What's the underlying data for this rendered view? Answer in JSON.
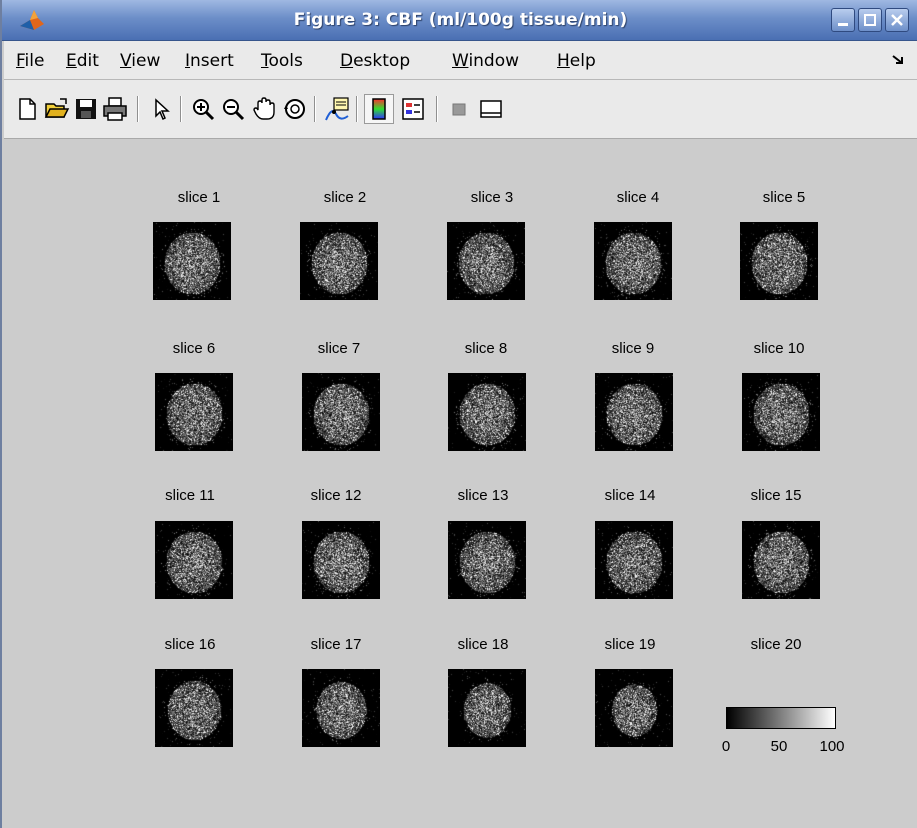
{
  "window": {
    "title": "Figure 3: CBF (ml/100g tissue/min)",
    "controls": [
      "minimize",
      "maximize",
      "close"
    ],
    "title_gradient": [
      "#9fb8e2",
      "#4a6fb3"
    ]
  },
  "menu": {
    "items": [
      {
        "label": "File",
        "mnemonic": "F",
        "rest": "ile"
      },
      {
        "label": "Edit",
        "mnemonic": "E",
        "rest": "dit"
      },
      {
        "label": "View",
        "mnemonic": "V",
        "rest": "iew"
      },
      {
        "label": "Insert",
        "mnemonic": "I",
        "rest": "nsert"
      },
      {
        "label": "Tools",
        "mnemonic": "T",
        "rest": "ools"
      },
      {
        "label": "Desktop",
        "mnemonic": "D",
        "rest": "esktop"
      },
      {
        "label": "Window",
        "mnemonic": "W",
        "rest": "indow"
      },
      {
        "label": "Help",
        "mnemonic": "H",
        "rest": "elp"
      }
    ]
  },
  "toolbar": {
    "icons": [
      "new-figure-icon",
      "open-file-icon",
      "save-icon",
      "print-icon",
      "edit-plot-arrow-icon",
      "zoom-in-icon",
      "zoom-out-icon",
      "pan-hand-icon",
      "rotate-3d-icon",
      "data-cursor-icon",
      "colorbar-icon",
      "legend-icon",
      "hide-plot-tools-icon",
      "show-plot-tools-icon"
    ]
  },
  "figure": {
    "slices": [
      {
        "label": "slice 1",
        "has_image": true
      },
      {
        "label": "slice 2",
        "has_image": true
      },
      {
        "label": "slice 3",
        "has_image": true
      },
      {
        "label": "slice 4",
        "has_image": true
      },
      {
        "label": "slice 5",
        "has_image": true
      },
      {
        "label": "slice 6",
        "has_image": true
      },
      {
        "label": "slice 7",
        "has_image": true
      },
      {
        "label": "slice 8",
        "has_image": true
      },
      {
        "label": "slice 9",
        "has_image": true
      },
      {
        "label": "slice 10",
        "has_image": true
      },
      {
        "label": "slice 11",
        "has_image": true
      },
      {
        "label": "slice 12",
        "has_image": true
      },
      {
        "label": "slice 13",
        "has_image": true
      },
      {
        "label": "slice 14",
        "has_image": true
      },
      {
        "label": "slice 15",
        "has_image": true
      },
      {
        "label": "slice 16",
        "has_image": true
      },
      {
        "label": "slice 17",
        "has_image": true
      },
      {
        "label": "slice 18",
        "has_image": true
      },
      {
        "label": "slice 19",
        "has_image": true
      },
      {
        "label": "slice 20",
        "has_image": false
      }
    ],
    "colorbar": {
      "ticks": [
        "0",
        "50",
        "100"
      ],
      "colormap": [
        "#000000",
        "#ffffff"
      ]
    }
  }
}
